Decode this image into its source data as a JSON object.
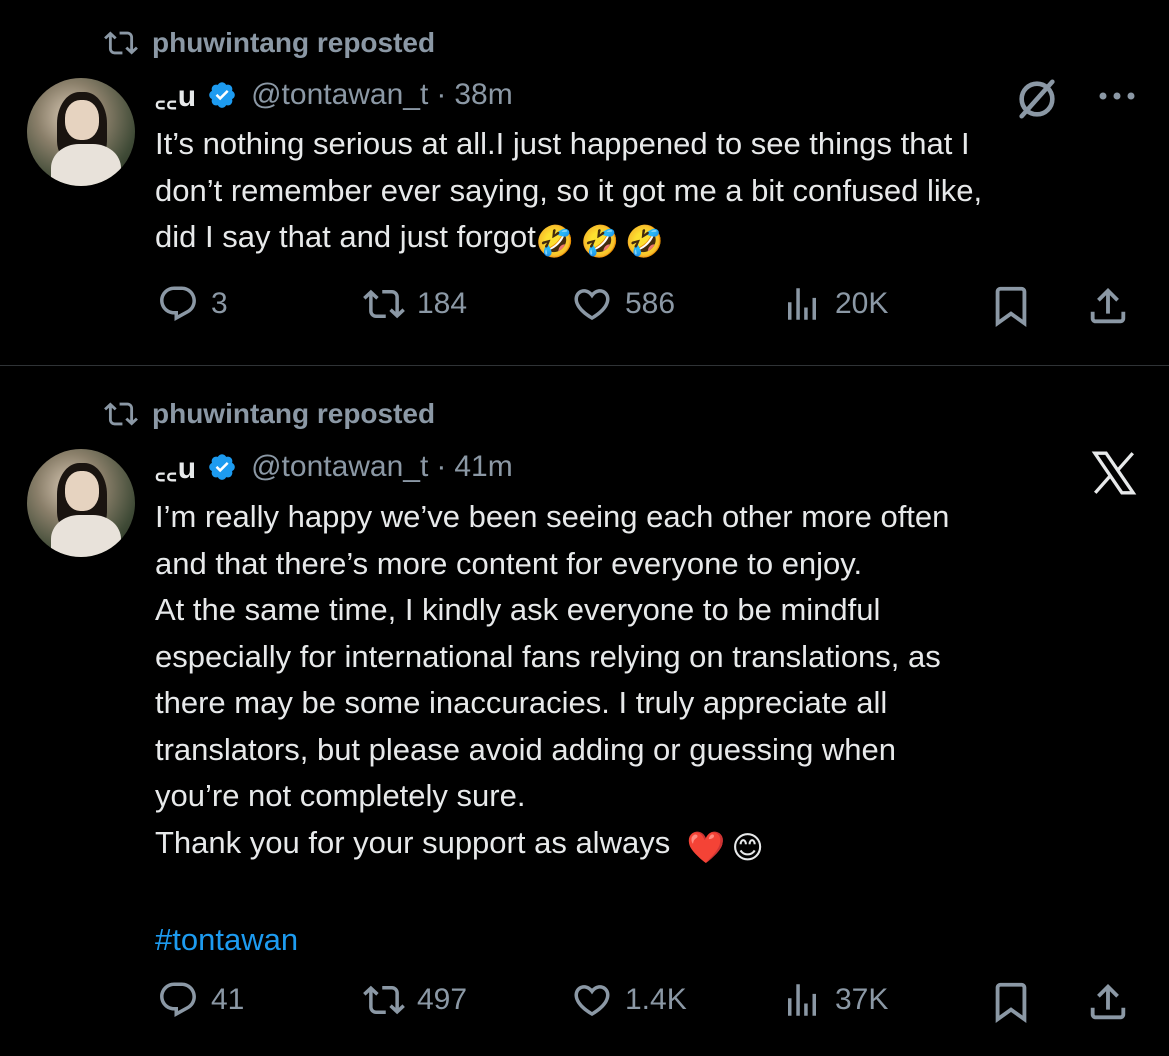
{
  "tweets": [
    {
      "repost_label": "phuwintang reposted",
      "author_name": "꜀꜀u",
      "handle": "@tontawan_t",
      "time": "38m",
      "body": [
        "It’s nothing serious at all.I just happened to see things that I",
        "don’t remember ever saying, so it got me a bit confused like,",
        "did I say that and just forgot"
      ],
      "emoji_trailing": [
        "🤣",
        "🤣",
        "🤣"
      ],
      "top_icons": [
        "slashed-circle-icon",
        "more-icon"
      ],
      "stats": {
        "replies": "3",
        "reposts": "184",
        "likes": "586",
        "views": "20K"
      }
    },
    {
      "repost_label": "phuwintang reposted",
      "author_name": "꜀꜀u",
      "handle": "@tontawan_t",
      "time": "41m",
      "body": [
        "I’m really happy we’ve been seeing each other more often",
        "and that there’s more content for everyone to enjoy.",
        "At the same time, I kindly ask everyone to be mindful",
        "especially for international fans relying on translations, as",
        "there may be some inaccuracies. I truly appreciate all",
        "translators, but please avoid adding or guessing when",
        "you’re not completely sure.",
        "Thank you for your support as always"
      ],
      "emoji_trailing": [
        "❤️",
        "😊"
      ],
      "hashtag": "#tontawan",
      "top_icons": [
        "x-logo-icon"
      ],
      "stats": {
        "replies": "41",
        "reposts": "497",
        "likes": "1.4K",
        "views": "37K"
      }
    }
  ],
  "colors": {
    "background": "#000000",
    "text": "#e7e9ea",
    "muted": "#8b98a5",
    "accent": "#1d9bf0",
    "badge": "#1d9bf0"
  }
}
